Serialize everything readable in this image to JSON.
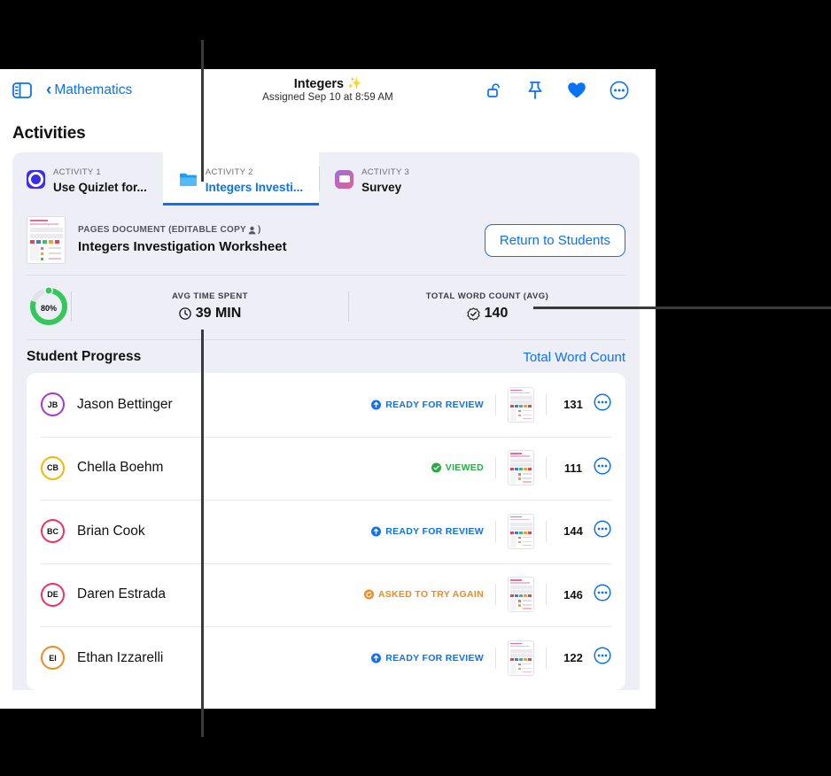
{
  "toolbar": {
    "sidebar_icon": "sidebar-toggle-icon",
    "back_label": "Mathematics",
    "title": "Integers",
    "title_emoji": "✨",
    "subtitle": "Assigned Sep 10 at 8:59 AM",
    "actions": [
      {
        "name": "unlock-icon",
        "label": "Unlock"
      },
      {
        "name": "pin-icon",
        "label": "Pin"
      },
      {
        "name": "heart-icon",
        "label": "Favorite"
      },
      {
        "name": "more-icon",
        "label": "More"
      }
    ],
    "accent_color": "#0a72f5"
  },
  "page_title": "Activities",
  "tabs": [
    {
      "kicker": "ACTIVITY 1",
      "name": "Use Quizlet for...",
      "icon": "quizlet-app-icon",
      "active": false
    },
    {
      "kicker": "ACTIVITY 2",
      "name": "Integers Investi...",
      "icon": "folder-icon",
      "active": true
    },
    {
      "kicker": "ACTIVITY 3",
      "name": "Survey",
      "icon": "survey-app-icon",
      "active": false
    }
  ],
  "document": {
    "kicker": "PAGES DOCUMENT (EDITABLE COPY",
    "kicker_icon": "person-icon",
    "kicker_close": ")",
    "name": "Integers Investigation Worksheet",
    "thumbnail": "worksheet-thumbnail",
    "return_button": "Return to Students"
  },
  "stats": {
    "ring": {
      "percent": 80,
      "label": "80%",
      "color": "#34c759",
      "track": "#e2e2ea"
    },
    "items": [
      {
        "kicker": "AVG TIME SPENT",
        "icon": "clock-icon",
        "value": "39 MIN"
      },
      {
        "kicker": "TOTAL WORD COUNT (AVG)",
        "icon": "checkmark-seal-icon",
        "value": "140"
      }
    ]
  },
  "student_progress": {
    "title": "Student Progress",
    "link": "Total Word Count",
    "column_meaning": "word-count",
    "rows": [
      {
        "initials": "JB",
        "ring_color": "#a734d6",
        "name": "Jason Bettinger",
        "status": "READY FOR REVIEW",
        "status_color": "#0a72f5",
        "status_icon": "arrow-up-circle-icon",
        "word_count": "131"
      },
      {
        "initials": "CB",
        "ring_color": "#f5b800",
        "name": "Chella Boehm",
        "status": "VIEWED",
        "status_color": "#27ae3f",
        "status_icon": "checkmark-circle-icon",
        "word_count": "111"
      },
      {
        "initials": "BC",
        "ring_color": "#f0325a",
        "name": "Brian Cook",
        "status": "READY FOR REVIEW",
        "status_color": "#0a72f5",
        "status_icon": "arrow-up-circle-icon",
        "word_count": "144"
      },
      {
        "initials": "DE",
        "ring_color": "#f0325a",
        "name": "Daren Estrada",
        "status": "ASKED TO TRY AGAIN",
        "status_color": "#f08a1e",
        "status_icon": "arrow-counterclockwise-circle-icon",
        "word_count": "146"
      },
      {
        "initials": "EI",
        "ring_color": "#f08a1e",
        "name": "Ethan Izzarelli",
        "status": "READY FOR REVIEW",
        "status_color": "#0a72f5",
        "status_icon": "arrow-up-circle-icon",
        "word_count": "122"
      }
    ]
  }
}
